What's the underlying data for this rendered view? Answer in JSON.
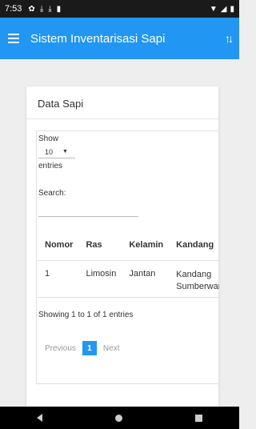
{
  "status_bar": {
    "time": "7:53"
  },
  "app_bar": {
    "title": "Sistem Inventarisasi Sapi"
  },
  "card": {
    "title": "Data Sapi",
    "show_label": "Show",
    "length_value": "10",
    "entries_label": "entries",
    "search_label": "Search:",
    "search_value": "",
    "table": {
      "headers": [
        "Nomor",
        "Ras",
        "Kelamin",
        "Kandang"
      ],
      "rows": [
        {
          "nomor": "1",
          "ras": "Limosin",
          "kelamin": "Jantan",
          "kandang": "Kandang Sumberwaru"
        }
      ]
    },
    "info": "Showing 1 to 1 of 1 entries",
    "pagination": {
      "previous": "Previous",
      "current": "1",
      "next": "Next"
    }
  },
  "colors": {
    "accent": "#2196f3",
    "statusbar": "#1a1a1a"
  }
}
